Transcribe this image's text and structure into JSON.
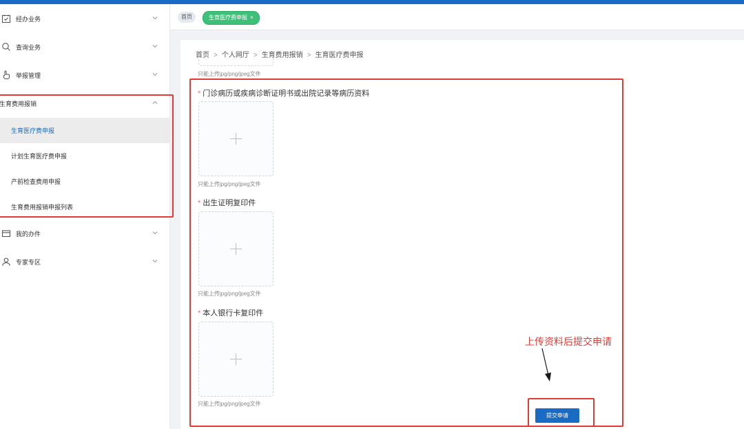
{
  "sidebar": {
    "items": [
      {
        "label": "经办业务",
        "icon": "calendar-check-icon"
      },
      {
        "label": "查询业务",
        "icon": "search-icon"
      },
      {
        "label": "举报管理",
        "icon": "hand-pointer-icon"
      },
      {
        "label": "生育费用报销",
        "icon": "none",
        "expanded": true
      },
      {
        "label": "我的办件",
        "icon": "card-icon"
      },
      {
        "label": "专家专区",
        "icon": "user-icon"
      }
    ],
    "subitems": [
      {
        "label": "生育医疗费申报",
        "active": true
      },
      {
        "label": "计划生育医疗费申报"
      },
      {
        "label": "产前检查费用申报"
      },
      {
        "label": "生育费用报销申报列表"
      }
    ]
  },
  "tabs": {
    "home": "首页",
    "active": "生育医疗费申报",
    "close": "×"
  },
  "breadcrumb": [
    "首页",
    "个人网厅",
    "生育费用报销",
    "生育医疗费申报"
  ],
  "breadcrumb_separator": ">",
  "form": {
    "hint": "只能上传jpg/png/jpeg文件",
    "required_mark": "*",
    "fields": [
      {
        "label": "门诊病历或疾病诊断证明书或出院记录等病历资料"
      },
      {
        "label": "出生证明复印件"
      },
      {
        "label": "本人银行卡复印件"
      }
    ],
    "submit_label": "提交申请"
  },
  "annotation": {
    "text": "上传资料后提交申请",
    "color": "#e53935"
  },
  "colors": {
    "brand": "#1a6bc4",
    "tab_active": "#3fc07a",
    "required": "#f56c6c"
  }
}
